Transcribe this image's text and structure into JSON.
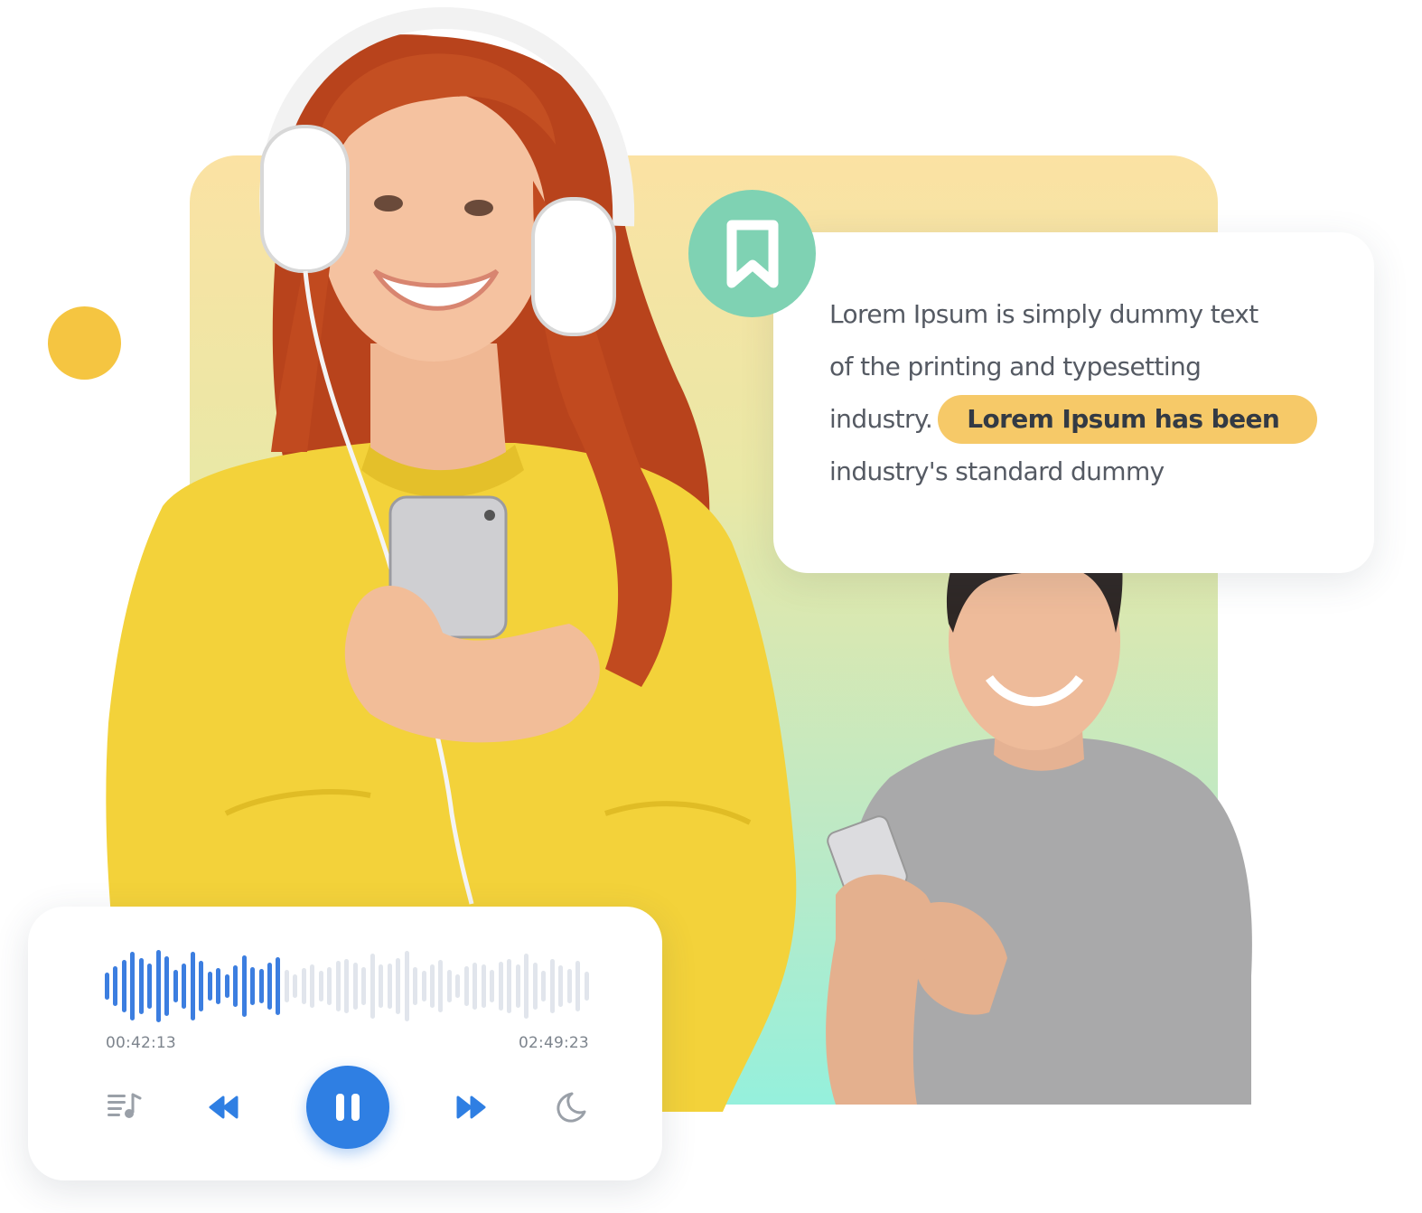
{
  "colors": {
    "accent_blue": "#2f7fe3",
    "highlight_yellow": "#f6c968",
    "bookmark_green": "#7fd2b3",
    "dot_yellow": "#f5c541",
    "wave_played": "#3c7ee0",
    "wave_unplayed": "#e1e5ec"
  },
  "quote": {
    "line1": "Lorem Ipsum is simply dummy text",
    "line2": "of the printing and typesetting",
    "line3": "industry.",
    "highlight": "Lorem Ipsum has been",
    "line4": "industry's standard dummy"
  },
  "player": {
    "elapsed": "00:42:13",
    "total": "02:49:23",
    "progress": 0.36,
    "controls": [
      "playlist-icon",
      "rewind-icon",
      "pause-icon",
      "fast-forward-icon",
      "sleep-timer-icon"
    ],
    "waveform": [
      0.36,
      0.52,
      0.7,
      0.9,
      0.74,
      0.6,
      0.95,
      0.78,
      0.42,
      0.6,
      0.9,
      0.66,
      0.38,
      0.48,
      0.3,
      0.55,
      0.82,
      0.5,
      0.46,
      0.62,
      0.76,
      0.44,
      0.32,
      0.48,
      0.58,
      0.4,
      0.5,
      0.66,
      0.72,
      0.62,
      0.5,
      0.86,
      0.58,
      0.6,
      0.74,
      0.92,
      0.5,
      0.4,
      0.56,
      0.68,
      0.44,
      0.32,
      0.52,
      0.62,
      0.58,
      0.44,
      0.64,
      0.72,
      0.56,
      0.86,
      0.62,
      0.4,
      0.72,
      0.54,
      0.46,
      0.66,
      0.38
    ]
  }
}
